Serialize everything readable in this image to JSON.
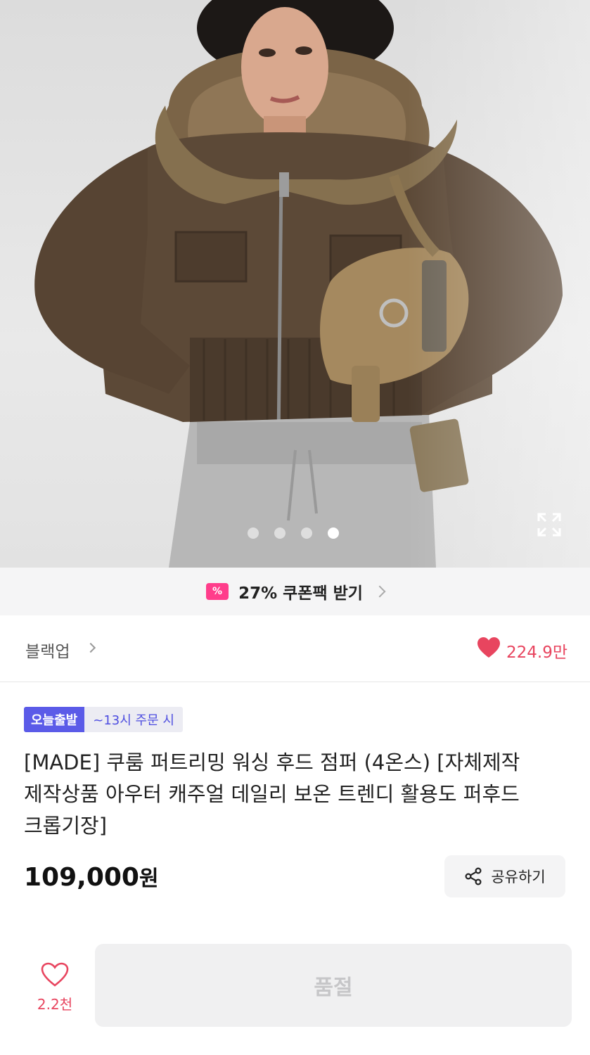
{
  "product_image": {
    "carousel_dots": 4,
    "active_index": 3,
    "expand_icon": "expand-icon"
  },
  "coupon": {
    "icon": "coupon-percent-icon",
    "icon_text": "%",
    "label": "27% 쿠폰팩 받기"
  },
  "shop": {
    "name": "블랙업",
    "like_count": "224.9만",
    "colors": {
      "accent": "#e8455f"
    }
  },
  "badges": {
    "shipping": "오늘출발",
    "cutoff": "~13시 주문 시"
  },
  "product": {
    "title": "[MADE] 쿠룸 퍼트리밍 워싱 후드 점퍼 (4온스) [자체제작 제작상품 아우터 캐주얼 데일리 보온 트렌디 활용도 퍼후드 크롭기장]",
    "price": "109,000",
    "price_unit": "원"
  },
  "actions": {
    "share_label": "공유하기",
    "wish_count": "2.2천",
    "buy_label": "품절"
  }
}
